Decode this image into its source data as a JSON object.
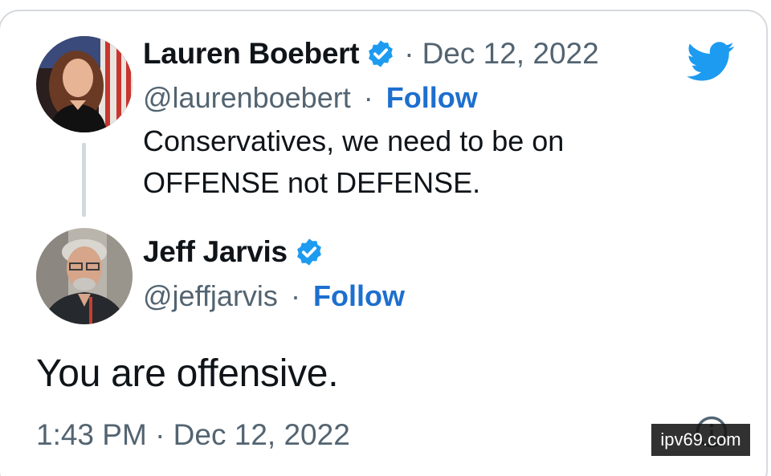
{
  "original_tweet": {
    "author_name": "Lauren Boebert",
    "handle": "@laurenboebert",
    "separator": "·",
    "date": "Dec 12, 2022",
    "follow_label": "Follow",
    "text_line1": "Conservatives, we need to be on",
    "text_line2": "OFFENSE not DEFENSE."
  },
  "reply_tweet": {
    "author_name": "Jeff Jarvis",
    "handle": "@jeffjarvis",
    "separator": "·",
    "follow_label": "Follow",
    "text": "You are offensive.",
    "timestamp": "1:43 PM · Dec 12, 2022"
  },
  "watermark": "ipv69.com",
  "icons": {
    "brand": "twitter-bird-icon",
    "verified": "verified-badge-icon",
    "info": "info-icon"
  },
  "colors": {
    "brand_blue": "#1d9bf0",
    "follow_blue": "#1d6fcf",
    "text_primary": "#0f1419",
    "text_secondary": "#536471",
    "border": "#d6dade"
  }
}
